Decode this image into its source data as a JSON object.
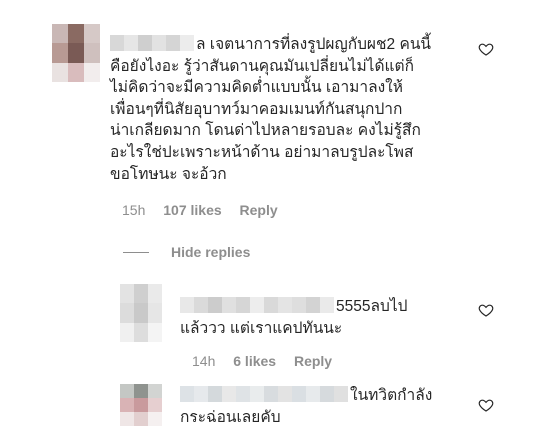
{
  "main_comment": {
    "lines": [
      "ล เจตนาการที่ลงรูปผญกับผช2 คนนี้",
      "คือยังไงอะ รู้ว่าสันดานคุณมันเปลี่ยนไม่ได้แต่ก็",
      "ไม่คิดว่าจะมีความคิดต่ำแบบนั้น เอามาลงให้",
      "เพื่อนๆที่นิสัยอุบาทว์มาคอมเมนท์กันสนุกปาก",
      "น่าเกลียดมาก โดนด่าไปหลายรอบละ คงไม่รู้สึก",
      "อะไรใช่ปะเพราะหน้าด้าน อย่ามาลบรูปละโพส",
      "ขอโทษนะ จะอ้วก"
    ],
    "time": "15h",
    "likes": "107 likes",
    "reply_label": "Reply"
  },
  "hide_replies_label": "Hide replies",
  "replies": [
    {
      "lines": [
        "5555ลบไป",
        "แล้ววว แต่เราแคปทันนะ"
      ],
      "time": "14h",
      "likes": "6 likes",
      "reply_label": "Reply"
    },
    {
      "lines": [
        "ในทวิตกำลัง",
        "กระฉ่อนเลยคับ"
      ]
    }
  ],
  "colors": {
    "text": "#262626",
    "meta": "#8e8e8e",
    "background": "#ffffff"
  },
  "icons": {
    "like": "heart-outline-icon"
  }
}
